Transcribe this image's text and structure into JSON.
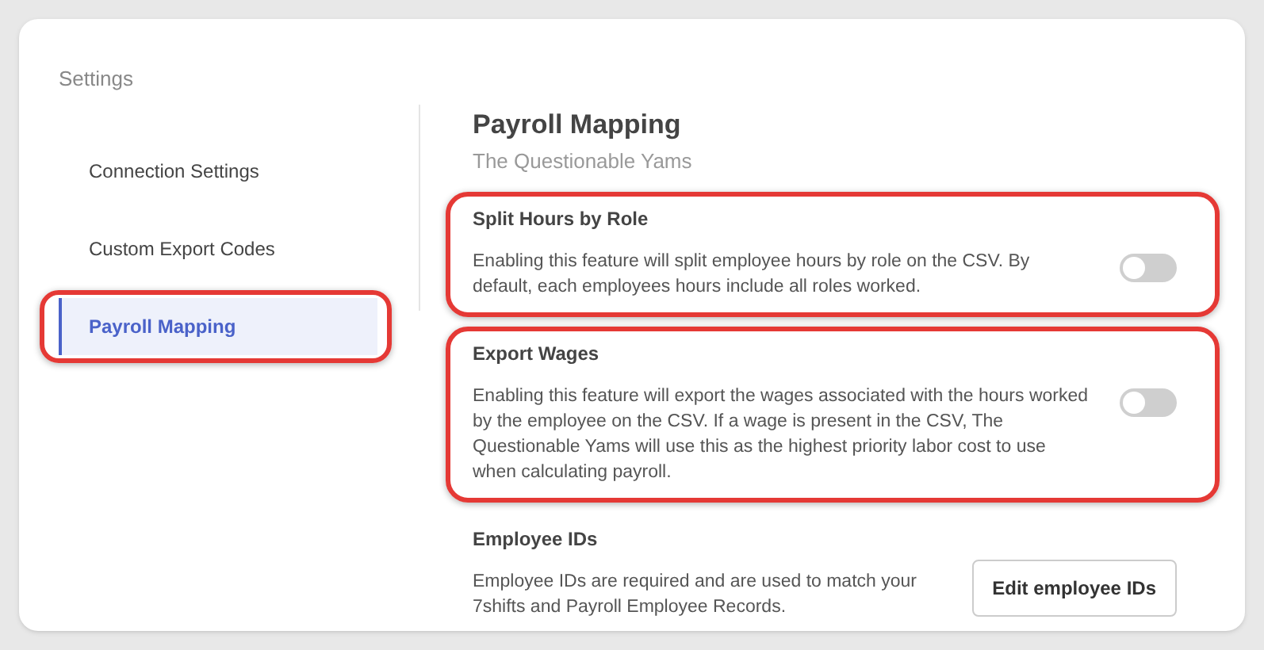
{
  "sidebar": {
    "title": "Settings",
    "items": [
      {
        "label": "Connection Settings",
        "selected": false,
        "highlighted": false
      },
      {
        "label": "Custom Export Codes",
        "selected": false,
        "highlighted": false
      },
      {
        "label": "Payroll Mapping",
        "selected": true,
        "highlighted": true
      }
    ]
  },
  "content": {
    "title": "Payroll Mapping",
    "subtitle": "The Questionable Yams",
    "sections": [
      {
        "kind": "toggle",
        "title": "Split Hours by Role",
        "text": "Enabling this feature will split employee hours by role on the CSV. By default, each employees hours include all roles worked.",
        "on": false,
        "highlighted": true
      },
      {
        "kind": "toggle",
        "title": "Export Wages",
        "text": "Enabling this feature will export the wages associated with the hours worked by the employee on the CSV. If a wage is present in the CSV, The Questionable Yams will use this as the highest priority labor cost to use when calculating payroll.",
        "on": false,
        "highlighted": true
      },
      {
        "kind": "button",
        "title": "Employee IDs",
        "text": "Employee IDs are required and are used to match your 7shifts and Payroll Employee Records.",
        "button": "Edit employee IDs",
        "highlighted": false
      }
    ]
  }
}
